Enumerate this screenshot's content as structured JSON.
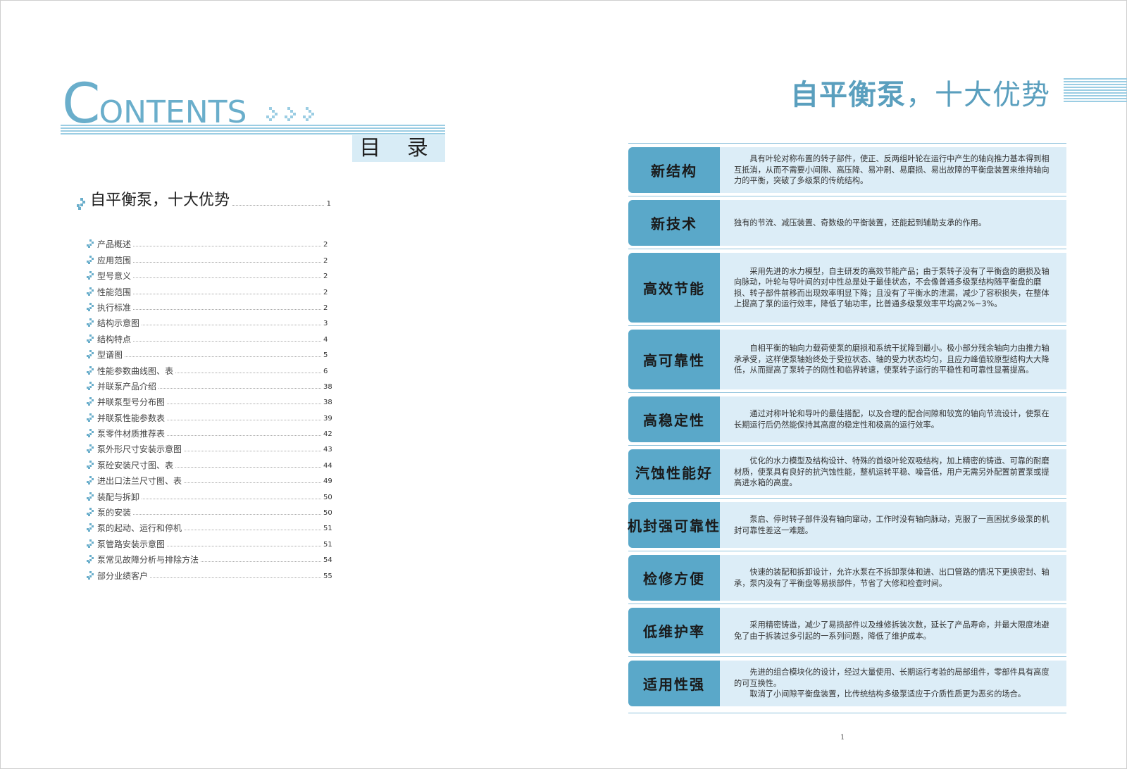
{
  "left_page": {
    "contents_title": {
      "first": "C",
      "rest": "ONTENTS"
    },
    "mulu": "目 录",
    "main_entry": {
      "title": "自平衡泵，十大优势",
      "page": "1"
    },
    "items": [
      {
        "label": "产品概述",
        "page": "2"
      },
      {
        "label": "应用范围",
        "page": "2"
      },
      {
        "label": "型号意义",
        "page": "2"
      },
      {
        "label": "性能范围",
        "page": "2"
      },
      {
        "label": "执行标准",
        "page": "2"
      },
      {
        "label": "结构示意图",
        "page": "3"
      },
      {
        "label": "结构特点",
        "page": "4"
      },
      {
        "label": "型谱图",
        "page": "5"
      },
      {
        "label": "性能参数曲线图、表",
        "page": "6"
      },
      {
        "label": "并联泵产品介绍",
        "page": "38"
      },
      {
        "label": "并联泵型号分布图",
        "page": "38"
      },
      {
        "label": "并联泵性能参数表",
        "page": "39"
      },
      {
        "label": "泵零件材质推荐表",
        "page": "42"
      },
      {
        "label": "泵外形尺寸安装示意图",
        "page": "43"
      },
      {
        "label": "泵砼安装尺寸图、表",
        "page": "44"
      },
      {
        "label": "进出口法兰尺寸图、表",
        "page": "49"
      },
      {
        "label": "装配与拆卸",
        "page": "50"
      },
      {
        "label": "泵的安装",
        "page": "50"
      },
      {
        "label": "泵的起动、运行和停机",
        "page": "51"
      },
      {
        "label": "泵管路安装示意图",
        "page": "51"
      },
      {
        "label": "泵常见故障分析与排除方法",
        "page": "54"
      },
      {
        "label": "部分业绩客户",
        "page": "55"
      }
    ]
  },
  "right_page": {
    "title_bold": "自平衡泵",
    "title_rest": "，十大优势",
    "advantages": [
      {
        "label": "新结构",
        "paragraphs": [
          "具有叶轮对称布置的转子部件，使正、反两组叶轮在运行中产生的轴向推力基本得到相互抵消，从而不需要小间隙、高压降、易冲刷、易磨损、易出故障的平衡盘装置来维持轴向力的平衡，突破了多级泵的传统结构。"
        ]
      },
      {
        "label": "新技术",
        "paragraphs": [
          "独有的节流、减压装置、奇数级的平衡装置，还能起到辅助支承的作用。"
        ],
        "noindent": true
      },
      {
        "label": "高效节能",
        "paragraphs": [
          "采用先进的水力模型，自主研发的高效节能产品；由于泵转子没有了平衡盘的磨损及轴向脉动，叶轮与导叶间的对中性总是处于最佳状态，不会像普通多级泵结构随平衡盘的磨损、转子部件前移而出现效率明显下降；且没有了平衡水的泄漏，减少了容积损失，在整体上提高了泵的运行效率，降低了轴功率，比普通多级泵效率平均高2%~3%。"
        ]
      },
      {
        "label": "高可靠性",
        "paragraphs": [
          "自相平衡的轴向力载荷使泵的磨损和系统干扰降到最小。极小部分残余轴向力由推力轴承承受，这样使泵轴始终处于受拉状态、轴的受力状态均匀，且应力峰值较原型结构大大降低，从而提高了泵转子的刚性和临界转速，使泵转子运行的平稳性和可靠性显著提高。"
        ]
      },
      {
        "label": "高稳定性",
        "paragraphs": [
          "通过对称叶轮和导叶的最佳搭配，以及合理的配合间隙和较宽的轴向节流设计，使泵在长期运行后仍然能保持其高度的稳定性和极高的运行效率。"
        ]
      },
      {
        "label": "汽蚀性能好",
        "paragraphs": [
          "优化的水力模型及结构设计、特殊的首级叶轮双吸结构，加上精密的铸造、可靠的耐磨材质，使泵具有良好的抗汽蚀性能，整机运转平稳、噪音低，用户无需另外配置前置泵或提高进水箱的高度。"
        ]
      },
      {
        "label": "机封强可靠性",
        "paragraphs": [
          "泵启、停时转子部件没有轴向窜动，工作时没有轴向脉动，克服了一直困扰多级泵的机封可靠性差这一难题。"
        ]
      },
      {
        "label": "检修方便",
        "paragraphs": [
          "快速的装配和拆卸设计，允许水泵在不拆卸泵体和进、出口管路的情况下更换密封、轴承，泵内没有了平衡盘等易损部件，节省了大修和检查时间。"
        ]
      },
      {
        "label": "低维护率",
        "paragraphs": [
          "采用精密铸造，减少了易损部件以及维修拆装次数，延长了产品寿命，并最大限度地避免了由于拆装过多引起的一系列问题，降低了维护成本。"
        ]
      },
      {
        "label": "适用性强",
        "paragraphs": [
          "先进的组合模块化的设计，经过大量使用、长期运行考验的局部组件，零部件具有高度的可互换性。",
          "取消了小间隙平衡盘装置，比传统结构多级泵适应于介质性质更为恶劣的场合。"
        ]
      }
    ],
    "page_number": "1"
  },
  "colors": {
    "accent": "#5aa8c9",
    "light_fill": "#dcedf7",
    "title_blue": "#5a9fbe"
  }
}
